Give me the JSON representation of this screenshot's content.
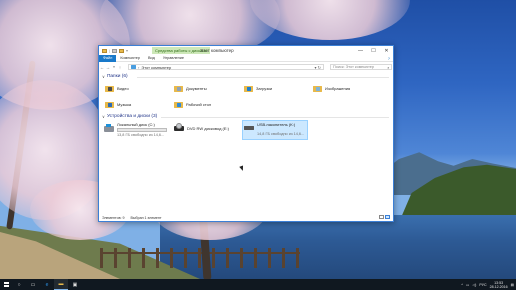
{
  "window": {
    "title": "Этот компьютер",
    "context_tab": "Средства работы с дисками",
    "controls": {
      "minimize": "—",
      "maximize": "☐",
      "close": "✕"
    }
  },
  "ribbon": {
    "tabs": [
      "Файл",
      "Компьютер",
      "Вид",
      "Управление"
    ],
    "help": "?"
  },
  "navigation": {
    "back": "←",
    "forward": "→",
    "up": "↑",
    "address_path": "Этот компьютер",
    "search_placeholder": "Поиск: Этот компьютер"
  },
  "folders_group": {
    "header": "Папки (6)",
    "items": [
      {
        "label": "Видео",
        "icon": "video-folder-icon",
        "badge_color": "#4a4a4a"
      },
      {
        "label": "Документы",
        "icon": "documents-folder-icon",
        "badge_color": "#8fa3b8"
      },
      {
        "label": "Загрузки",
        "icon": "downloads-folder-icon",
        "badge_color": "#1e7fd0"
      },
      {
        "label": "Изображения",
        "icon": "pictures-folder-icon",
        "badge_color": "#7fb3d9"
      },
      {
        "label": "Музыка",
        "icon": "music-folder-icon",
        "badge_color": "#2d6bb5"
      },
      {
        "label": "Рабочий стол",
        "icon": "desktop-folder-icon",
        "badge_color": "#2f8ad8"
      }
    ]
  },
  "devices_group": {
    "header": "Устройства и диски (3)",
    "drives": [
      {
        "name": "Локальный диск (C:)",
        "free": "13,8 ГБ свободно из 14,6...",
        "used_fraction": 0.06,
        "icon": "local-disk-icon"
      },
      {
        "name": "DVD RW дисковод (E:)",
        "free": "",
        "icon": "dvd-drive-icon"
      },
      {
        "name": "USB-накопитель (K:)",
        "free": "14,8 ГБ свободно из 14,6...",
        "icon": "usb-drive-icon"
      }
    ]
  },
  "status": {
    "items_count": "Элементов: 9",
    "selected": "Выбран 1 элемент"
  },
  "taskbar": {
    "language": "РУС",
    "time": "13:53",
    "date": "28.12.2016"
  },
  "colors": {
    "accent": "#1979ca",
    "selection": "#cce8ff",
    "folder": "#e8b94a",
    "drive_bar": "#26a0da"
  }
}
